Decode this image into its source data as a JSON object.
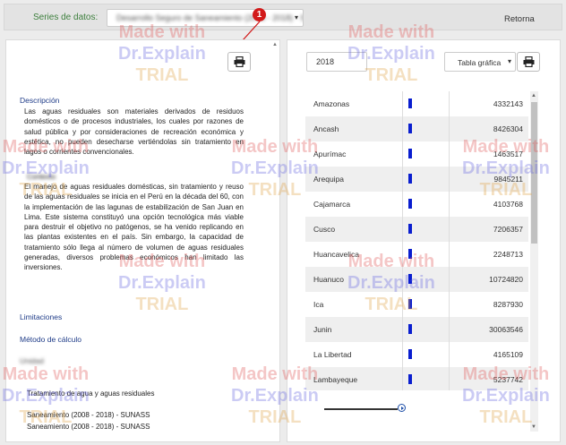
{
  "topbar": {
    "series_label": "Series de datos:",
    "series_value": "Desarrollo Seguro de Saneamiento (2008 - 2018) - SUNASS",
    "chevron": "▾",
    "retorna": "Retorna"
  },
  "callout": {
    "number": "1"
  },
  "left_panel": {
    "sections": {
      "descripcion": "Descripción",
      "limitaciones": "Limitaciones",
      "metodo": "Método de cálculo",
      "fuente_blur": "Unidad"
    },
    "desc_paragraph_1": "Las aguas residuales son materiales derivados de residuos domésticos o de procesos industriales, los cuales por razones de salud pública y por consideraciones de recreación económica y estética, no pueden desecharse vertiéndolas sin tratamiento en lagos o corrientes convencionales.",
    "desc_blur_heading": "Contexto",
    "desc_paragraph_2": "El manejo de aguas residuales domésticas, sin tratamiento y reuso de las aguas residuales se inicia en el Perú en la década del 60, con la implementación de las lagunas de estabilización de San Juan en Lima. Este sistema constituyó una opción tecnológica más viable para destruir el objetivo no patógenos, se ha venido replicando en las plantas existentes en el país. Sin embargo, la capacidad de tratamiento sólo llega al número de volumen de aguas residuales generadas, diversos problemas económicos han limitado las inversiones.",
    "bottom_lines": {
      "line1": "Tratamiento de agua y aguas residuales",
      "line2": "Saneamiento (2008 - 2018) - SUNASS",
      "line3": "Saneamiento (2008 - 2018) - SUNASS"
    }
  },
  "right_panel": {
    "year": "2018",
    "chart_select": "Tabla gráfica",
    "chevron": "▾",
    "rows": [
      {
        "name": "Amazonas",
        "value": "4332143"
      },
      {
        "name": "Ancash",
        "value": "8426304"
      },
      {
        "name": "Apurímac",
        "value": "1463517"
      },
      {
        "name": "Arequipa",
        "value": "9845211"
      },
      {
        "name": "Cajamarca",
        "value": "4103768"
      },
      {
        "name": "Cusco",
        "value": "7206357"
      },
      {
        "name": "Huancavelica",
        "value": "2248713"
      },
      {
        "name": "Huanuco",
        "value": "10724820"
      },
      {
        "name": "Ica",
        "value": "8287930"
      },
      {
        "name": "Junin",
        "value": "30063546"
      },
      {
        "name": "La Libertad",
        "value": "4165109"
      },
      {
        "name": "Lambayeque",
        "value": "5237742"
      }
    ]
  },
  "watermark": {
    "line1": "Made with",
    "line2": "Dr.Explain",
    "line3": "TRIAL"
  },
  "colors": {
    "bar": "#0a1ecf",
    "callout": "#d21a1a",
    "section_title": "#1f3c88",
    "series_label": "#3d7f3d"
  }
}
